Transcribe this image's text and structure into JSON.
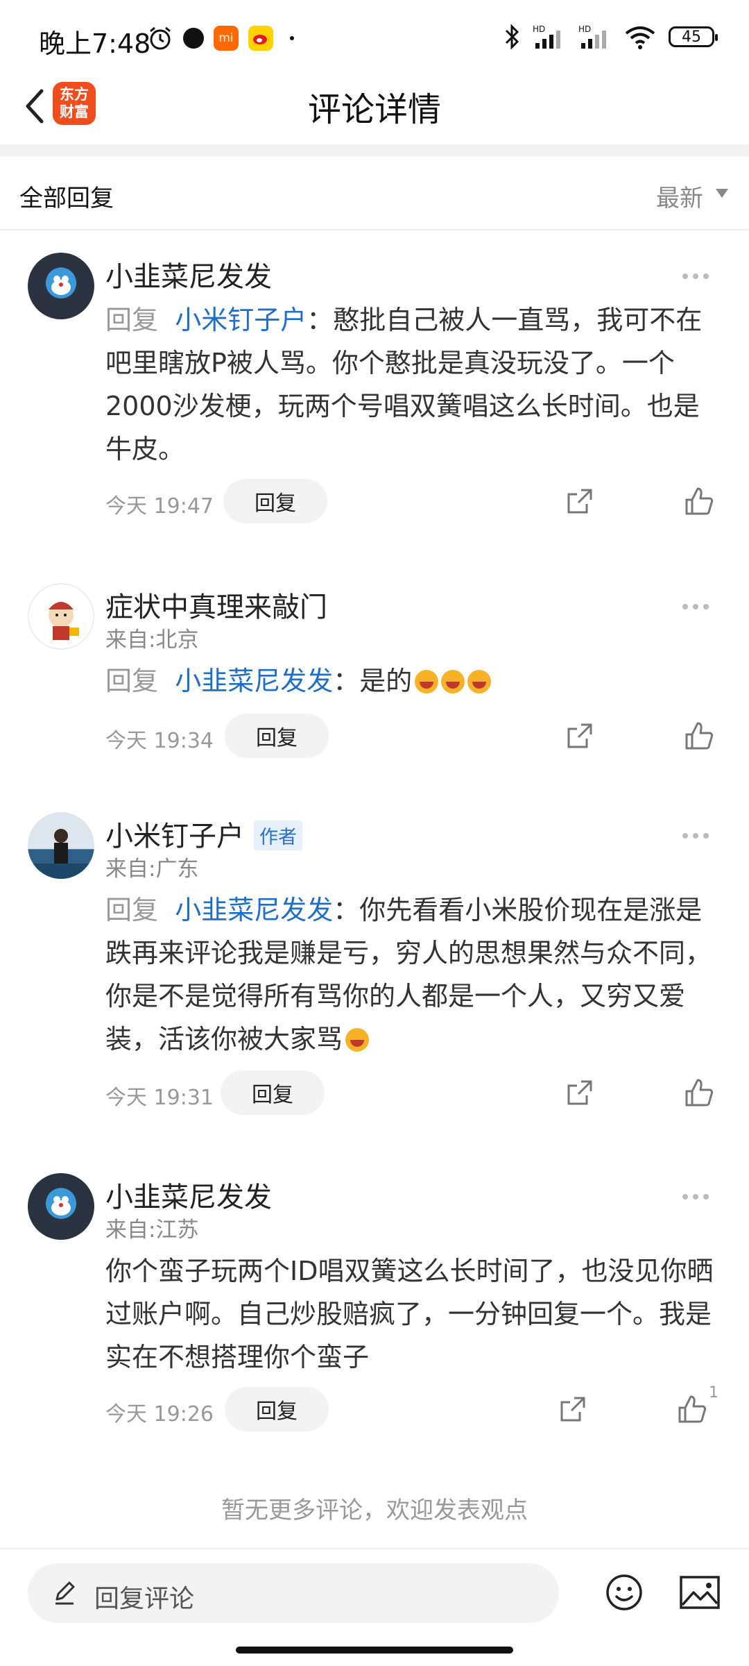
{
  "status_bar": {
    "time": "晚上7:48",
    "battery": "45",
    "icons_left": [
      "alarm-icon",
      "dark-app-icon",
      "mi-app-icon",
      "weibo-icon"
    ],
    "icons_right": [
      "bluetooth-icon",
      "signal-hd-icon",
      "signal-hd-icon",
      "wifi-icon"
    ]
  },
  "header": {
    "title": "评论详情",
    "logo_text": "东方\n财富",
    "colors": {
      "logo": "#f04c1c"
    }
  },
  "filter": {
    "label": "全部回复",
    "sort": "最新"
  },
  "comments": [
    {
      "user": "小韭菜尼发发",
      "location": "",
      "reply_prefix": "回复",
      "mention": "小米钉子户",
      "separator": "：",
      "text": "憨批自己被人一直骂，我可不在吧里瞎放P被人骂。你个憨批是真没玩没了。一个2000沙发梗，玩两个号唱双簧唱这么长时间。也是牛皮。",
      "time": "今天 19:47",
      "reply_label": "回复",
      "likes": ""
    },
    {
      "user": "症状中真理来敲门",
      "location": "来自:北京",
      "reply_prefix": "回复",
      "mention": "小韭菜尼发发",
      "separator": "：",
      "text": "是的",
      "time": "今天 19:34",
      "reply_label": "回复",
      "likes": ""
    },
    {
      "user": "小米钉子户",
      "badge": "作者",
      "location": "来自:广东",
      "reply_prefix": "回复",
      "mention": "小韭菜尼发发",
      "separator": "：",
      "text": "你先看看小米股价现在是涨是跌再来评论我是赚是亏，穷人的思想果然与众不同，你是不是觉得所有骂你的人都是一个人，又穷又爱装，活该你被大家骂",
      "time": "今天 19:31",
      "reply_label": "回复",
      "likes": ""
    },
    {
      "user": "小韭菜尼发发",
      "location": "来自:江苏",
      "text": "你个蛮子玩两个ID唱双簧这么长时间了，也没见你晒过账户啊。自己炒股赔疯了，一分钟回复一个。我是实在不想搭理你个蛮子",
      "time": "今天 19:26",
      "reply_label": "回复",
      "likes": "1"
    }
  ],
  "footer": {
    "message": "暂无更多评论，欢迎发表观点"
  },
  "bottom_bar": {
    "placeholder": "回复评论"
  }
}
